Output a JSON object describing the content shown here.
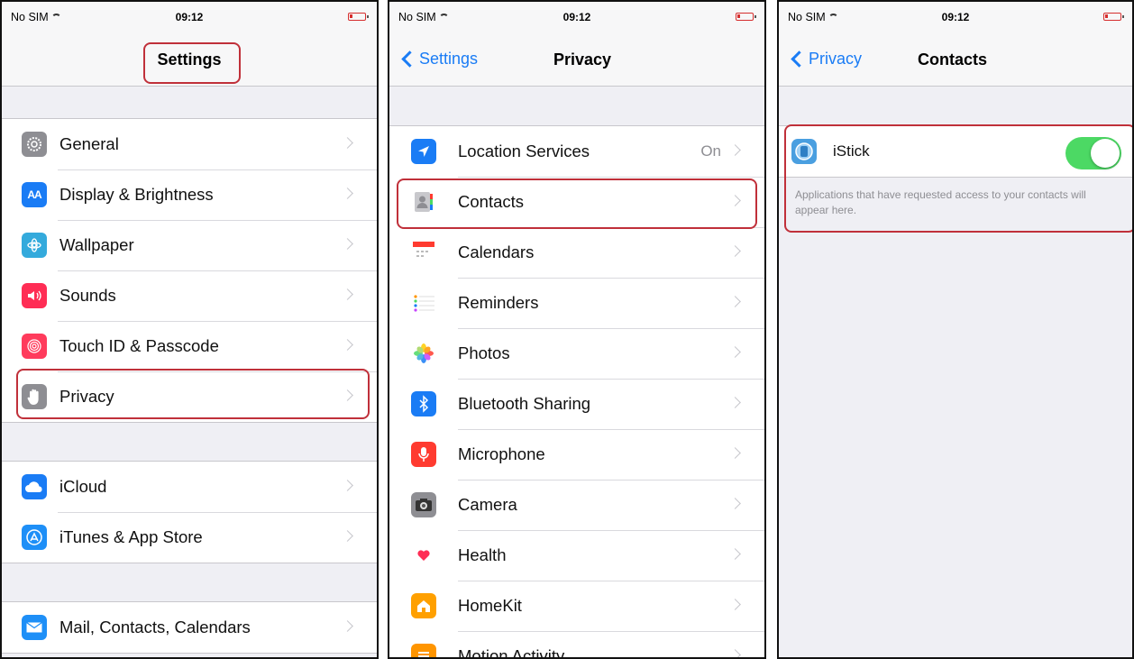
{
  "status": {
    "carrier": "No SIM",
    "time": "09:12"
  },
  "screen1": {
    "title": "Settings",
    "group1": [
      {
        "label": "General",
        "icon": "gear-icon",
        "color": "#8e8e93"
      },
      {
        "label": "Display & Brightness",
        "icon": "display-brightness-icon",
        "color": "#1a7cf5"
      },
      {
        "label": "Wallpaper",
        "icon": "wallpaper-flower-icon",
        "color": "#34aadc"
      },
      {
        "label": "Sounds",
        "icon": "speaker-icon",
        "color": "#ff2d55"
      },
      {
        "label": "Touch ID & Passcode",
        "icon": "fingerprint-icon",
        "color": "#ff3b5c"
      },
      {
        "label": "Privacy",
        "icon": "hand-icon",
        "color": "#8e8e93"
      }
    ],
    "group2": [
      {
        "label": "iCloud",
        "icon": "cloud-icon",
        "color": "#1a7cf5"
      },
      {
        "label": "iTunes & App Store",
        "icon": "app-store-icon",
        "color": "#1e8ff7"
      }
    ],
    "group3": [
      {
        "label": "Mail, Contacts, Calendars",
        "icon": "mail-icon",
        "color": "#1e8ff7"
      }
    ]
  },
  "screen2": {
    "back_label": "Settings",
    "title": "Privacy",
    "rows": [
      {
        "label": "Location Services",
        "value": "On",
        "icon": "location-arrow-icon",
        "color": "#1a7cf5"
      },
      {
        "label": "Contacts",
        "icon": "contacts-icon",
        "color": "#a7a7ac"
      },
      {
        "label": "Calendars",
        "icon": "calendar-icon",
        "color": "#ff3b30"
      },
      {
        "label": "Reminders",
        "icon": "reminders-list-icon",
        "color": "#c7c7cc"
      },
      {
        "label": "Photos",
        "icon": "photos-flower-icon",
        "color": "#ff9500"
      },
      {
        "label": "Bluetooth Sharing",
        "icon": "bluetooth-icon",
        "color": "#1a7cf5"
      },
      {
        "label": "Microphone",
        "icon": "microphone-icon",
        "color": "#ff3b30"
      },
      {
        "label": "Camera",
        "icon": "camera-icon",
        "color": "#8e8e93"
      },
      {
        "label": "Health",
        "icon": "heart-icon",
        "color": "#ff2d55"
      },
      {
        "label": "HomeKit",
        "icon": "home-icon",
        "color": "#ffa000"
      },
      {
        "label": "Motion Activity",
        "icon": "motion-activity-icon",
        "color": "#ff9500"
      }
    ]
  },
  "screen3": {
    "back_label": "Privacy",
    "title": "Contacts",
    "app": {
      "label": "iStick",
      "icon": "istick-app-icon",
      "toggle_on": true
    },
    "footnote": "Applications that have requested access to your contacts will appear here."
  }
}
